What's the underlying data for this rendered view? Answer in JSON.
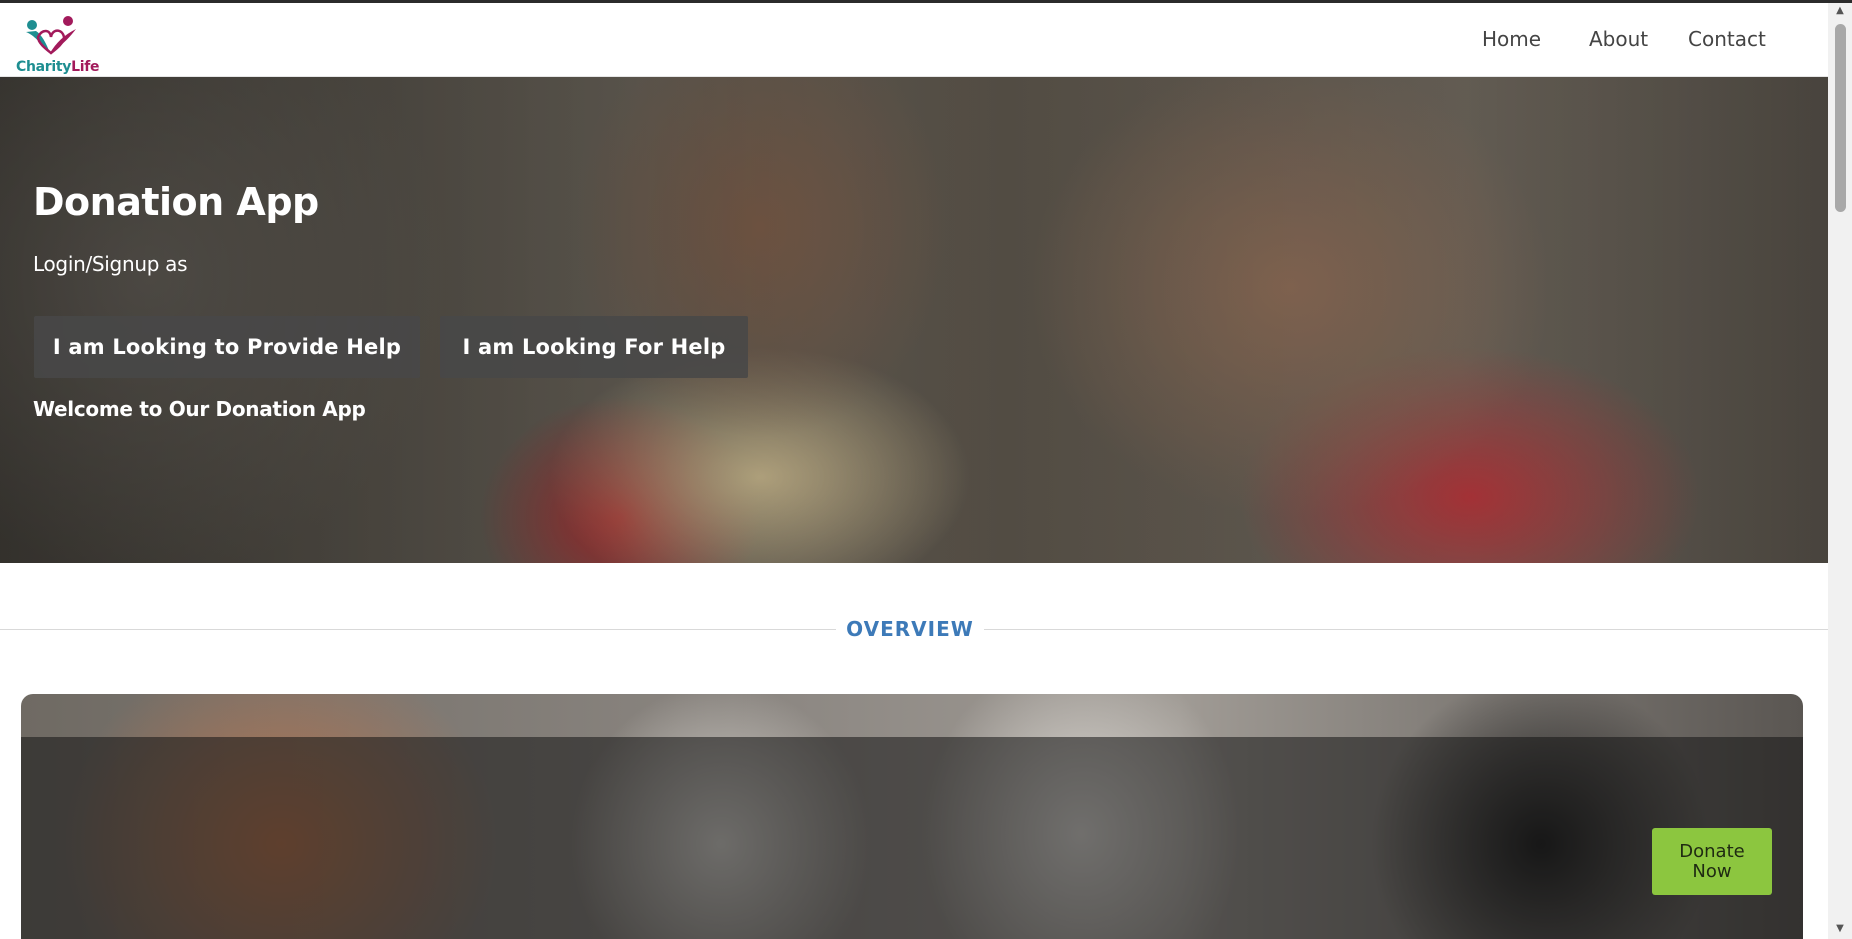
{
  "brand": {
    "logo_text_part1": "Charity",
    "logo_text_part2": "Life",
    "primary_color": "#1e8e91",
    "secondary_color": "#a21a5b"
  },
  "nav": {
    "items": [
      {
        "label": "Home"
      },
      {
        "label": "About"
      },
      {
        "label": "Contact"
      }
    ]
  },
  "hero": {
    "title": "Donation App",
    "subtitle": "Login/Signup as",
    "buttons": [
      {
        "label": "I am Looking to Provide Help"
      },
      {
        "label": "I am Looking For Help"
      }
    ],
    "welcome": "Welcome to Our Donation App"
  },
  "overview": {
    "heading": "OVERVIEW",
    "heading_color": "#3d7ab8",
    "donate_line1": "Donate",
    "donate_line2": "Now",
    "donate_color": "#8cc63f"
  },
  "icons": {
    "logo": "charity-heart-icon",
    "scroll_up": "scroll-up-arrow-icon",
    "scroll_down": "scroll-down-arrow-icon"
  }
}
